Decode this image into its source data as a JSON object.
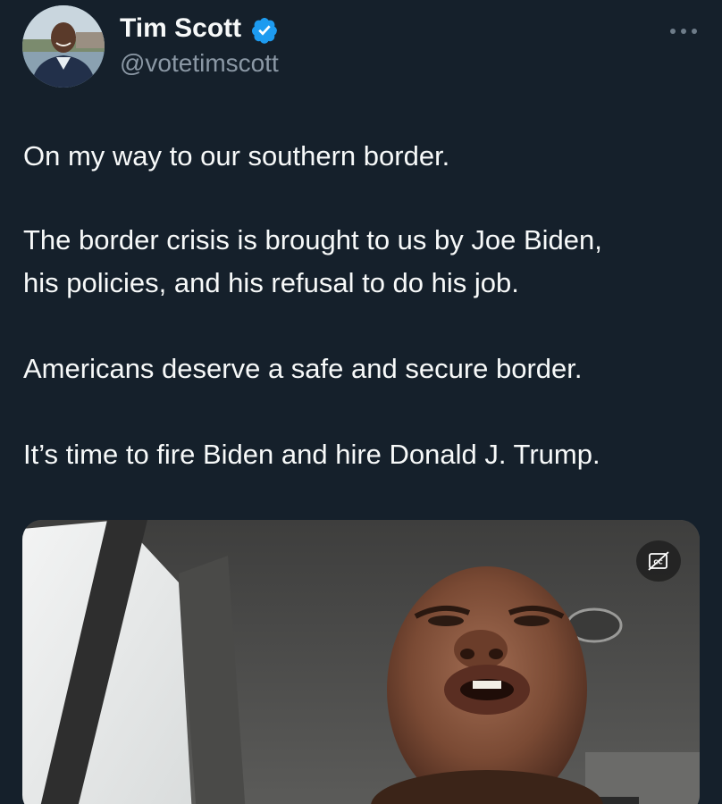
{
  "tweet": {
    "author": {
      "name": "Tim Scott",
      "handle": "@votetimscott",
      "verified": true
    },
    "text_lines": [
      "On my way to our southern border.",
      "The border crisis is brought to us by Joe Biden,",
      "his policies, and his refusal to do his job.",
      "Americans deserve a safe and secure border.",
      "It’s time to fire Biden and hire Donald J. Trump."
    ],
    "media": {
      "type": "video",
      "captions_icon": "closed-captions-off-icon"
    }
  },
  "icons": {
    "verified": "verified-badge-icon",
    "more": "more-options-icon"
  },
  "colors": {
    "background": "#15202b",
    "text": "#f7f9f9",
    "secondary_text": "#8b98a5",
    "verified_blue": "#1d9bf0"
  }
}
